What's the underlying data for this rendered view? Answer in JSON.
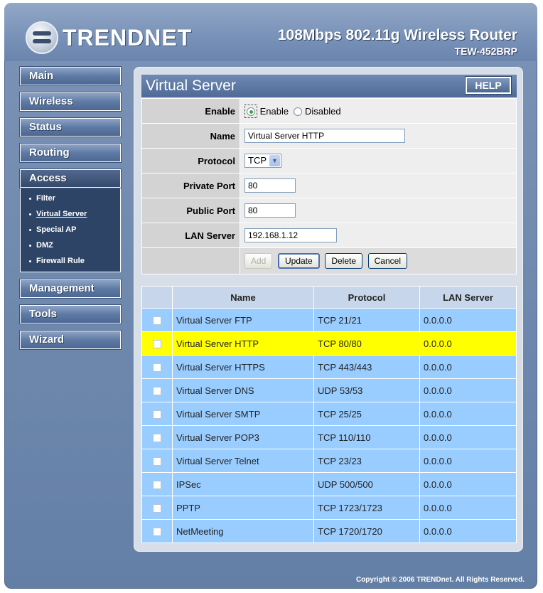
{
  "brand": {
    "logo_text": "TRENDNET"
  },
  "product": {
    "title": "108Mbps 802.11g Wireless Router",
    "model": "TEW-452BRP"
  },
  "nav": {
    "main": "Main",
    "wireless": "Wireless",
    "status": "Status",
    "routing": "Routing",
    "access": "Access",
    "access_items": [
      "Filter",
      "Virtual Server",
      "Special AP",
      "DMZ",
      "Firewall Rule"
    ],
    "management": "Management",
    "tools": "Tools",
    "wizard": "Wizard"
  },
  "panel": {
    "title": "Virtual Server",
    "help_label": "HELP"
  },
  "form": {
    "enable_label": "Enable",
    "enable_option": "Enable",
    "disabled_option": "Disabled",
    "enable_selected": "Enable",
    "name_label": "Name",
    "name_value": "Virtual Server HTTP",
    "protocol_label": "Protocol",
    "protocol_value": "TCP",
    "private_port_label": "Private Port",
    "private_port_value": "80",
    "public_port_label": "Public Port",
    "public_port_value": "80",
    "lan_server_label": "LAN Server",
    "lan_server_value": "192.168.1.12",
    "add_label": "Add",
    "update_label": "Update",
    "delete_label": "Delete",
    "cancel_label": "Cancel"
  },
  "list": {
    "headers": [
      "Name",
      "Protocol",
      "LAN Server"
    ],
    "rows": [
      {
        "name": "Virtual Server FTP",
        "protocol": "TCP 21/21",
        "lan": "0.0.0.0",
        "highlight": false
      },
      {
        "name": "Virtual Server HTTP",
        "protocol": "TCP 80/80",
        "lan": "0.0.0.0",
        "highlight": true
      },
      {
        "name": "Virtual Server HTTPS",
        "protocol": "TCP 443/443",
        "lan": "0.0.0.0",
        "highlight": false
      },
      {
        "name": "Virtual Server DNS",
        "protocol": "UDP 53/53",
        "lan": "0.0.0.0",
        "highlight": false
      },
      {
        "name": "Virtual Server SMTP",
        "protocol": "TCP 25/25",
        "lan": "0.0.0.0",
        "highlight": false
      },
      {
        "name": "Virtual Server POP3",
        "protocol": "TCP 110/110",
        "lan": "0.0.0.0",
        "highlight": false
      },
      {
        "name": "Virtual Server Telnet",
        "protocol": "TCP 23/23",
        "lan": "0.0.0.0",
        "highlight": false
      },
      {
        "name": "IPSec",
        "protocol": "UDP 500/500",
        "lan": "0.0.0.0",
        "highlight": false
      },
      {
        "name": "PPTP",
        "protocol": "TCP 1723/1723",
        "lan": "0.0.0.0",
        "highlight": false
      },
      {
        "name": "NetMeeting",
        "protocol": "TCP 1720/1720",
        "lan": "0.0.0.0",
        "highlight": false
      }
    ]
  },
  "footer": {
    "copyright": "Copyright © 2006 TRENDnet. All Rights Reserved."
  },
  "colors": {
    "row_blue": "#99ccff",
    "row_highlight": "#ffff00",
    "frame": "#647fa6"
  }
}
